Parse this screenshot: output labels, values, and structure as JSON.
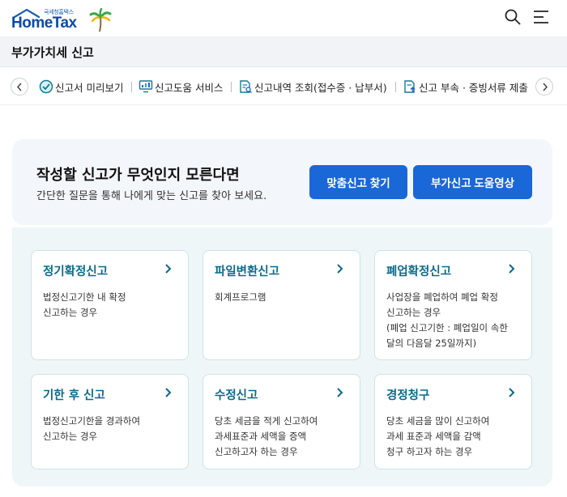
{
  "header": {
    "logo_sub": "국세청홈택스",
    "logo_main": "HomeTax"
  },
  "subheader": {
    "title": "부가가치세 신고"
  },
  "tabs": [
    {
      "label": "신고서 미리보기",
      "icon": "check-circle-icon"
    },
    {
      "label": "신고도움 서비스",
      "icon": "monitor-chart-icon"
    },
    {
      "label": "신고내역 조회(접수증 · 납부서)",
      "icon": "document-search-icon"
    },
    {
      "label": "신고 부속 · 증빙서류 제출",
      "icon": "document-upload-icon"
    }
  ],
  "hero": {
    "title": "작성할 신고가 무엇인지 모른다면",
    "description": "간단한 질문을 통해 나에게 맞는 신고를 찾아 보세요.",
    "button_find": "맞춤신고 찾기",
    "button_video": "부가신고 도움영상"
  },
  "cards": [
    {
      "title": "정기확정신고",
      "lines": [
        "법정신고기한 내 확정",
        "신고하는 경우"
      ]
    },
    {
      "title": "파일변환신고",
      "lines": [
        "회계프로그램"
      ]
    },
    {
      "title": "폐업확정신고",
      "lines": [
        "사업장을 폐업하여 폐업 확정",
        "신고하는 경우",
        "(폐업 신고기한 : 폐업일이 속한",
        "달의 다음달 25일까지)"
      ]
    },
    {
      "title": "기한 후 신고",
      "lines": [
        "법정신고기한을 경과하여",
        "신고하는 경우"
      ]
    },
    {
      "title": "수정신고",
      "lines": [
        "당초 세금을 적게 신고하여",
        "과세표준과 세액을 증액",
        "신고하고자 하는 경우"
      ]
    },
    {
      "title": "경정청구",
      "lines": [
        "당초 세금을 많이 신고하여",
        "과세 표준과 세액을 감액",
        "청구 하고자 하는 경우"
      ]
    }
  ],
  "colors": {
    "primary_button": "#1a67d8",
    "card_title": "#0b6a8a",
    "cards_background": "#eef6f8",
    "hero_background": "#f3f6fb"
  }
}
